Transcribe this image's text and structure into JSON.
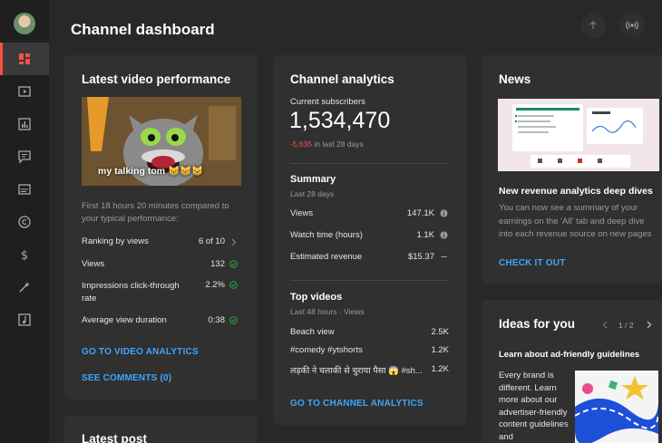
{
  "header": {
    "title": "Channel dashboard"
  },
  "sidebar": {
    "items": [
      {
        "name": "dashboard-icon"
      },
      {
        "name": "content-icon"
      },
      {
        "name": "analytics-icon"
      },
      {
        "name": "comments-icon"
      },
      {
        "name": "subtitles-icon"
      },
      {
        "name": "copyright-icon"
      },
      {
        "name": "earn-icon"
      },
      {
        "name": "customization-icon"
      },
      {
        "name": "audio-library-icon"
      }
    ]
  },
  "latest_video": {
    "title": "Latest video performance",
    "thumbnail_caption": "my talking tom 😸😸😸",
    "compare_text": "First 18 hours 20 minutes compared to your typical performance:",
    "metrics": [
      {
        "label": "Ranking by views",
        "value": "6 of 10"
      },
      {
        "label": "Views",
        "value": "132"
      },
      {
        "label": "Impressions click-through rate",
        "value": "2.2%"
      },
      {
        "label": "Average view duration",
        "value": "0:38"
      }
    ],
    "analytics_link": "GO TO VIDEO ANALYTICS",
    "comments_link": "SEE COMMENTS (0)"
  },
  "latest_post": {
    "title": "Latest post"
  },
  "channel_analytics": {
    "title": "Channel analytics",
    "subs_label": "Current subscribers",
    "subs_value": "1,534,470",
    "subs_change": "-5,635",
    "subs_period": " in last 28 days",
    "summary_title": "Summary",
    "summary_period": "Last 28 days",
    "summary": [
      {
        "label": "Views",
        "value": "147.1K"
      },
      {
        "label": "Watch time (hours)",
        "value": "1.1K"
      },
      {
        "label": "Estimated revenue",
        "value": "$15.37"
      }
    ],
    "top_videos_title": "Top videos",
    "top_videos_period": "Last 48 hours · Views",
    "top_videos": [
      {
        "label": "Beach view",
        "value": "2.5K"
      },
      {
        "label": "#comedy #ytshorts",
        "value": "1.2K"
      },
      {
        "label": "लड़की ने चलाकी से चुराया पैसा 😱 #sh...",
        "value": "1.2K"
      }
    ],
    "link": "GO TO CHANNEL ANALYTICS"
  },
  "news": {
    "title": "News",
    "headline": "New revenue analytics deep dives",
    "body": "You can now see a summary of your earnings on the 'All' tab and deep dive into each revenue source on new pages",
    "link": "CHECK IT OUT"
  },
  "ideas": {
    "title": "Ideas for you",
    "pager": "1 / 2",
    "headline": "Learn about ad-friendly guidelines",
    "body": "Every brand is different. Learn more about our advertiser-friendly content guidelines and"
  },
  "colors": {
    "accent_link": "#3ea6ff",
    "active_nav": "#ff4e45",
    "negative": "#ff4e45",
    "check": "#2ba640"
  }
}
